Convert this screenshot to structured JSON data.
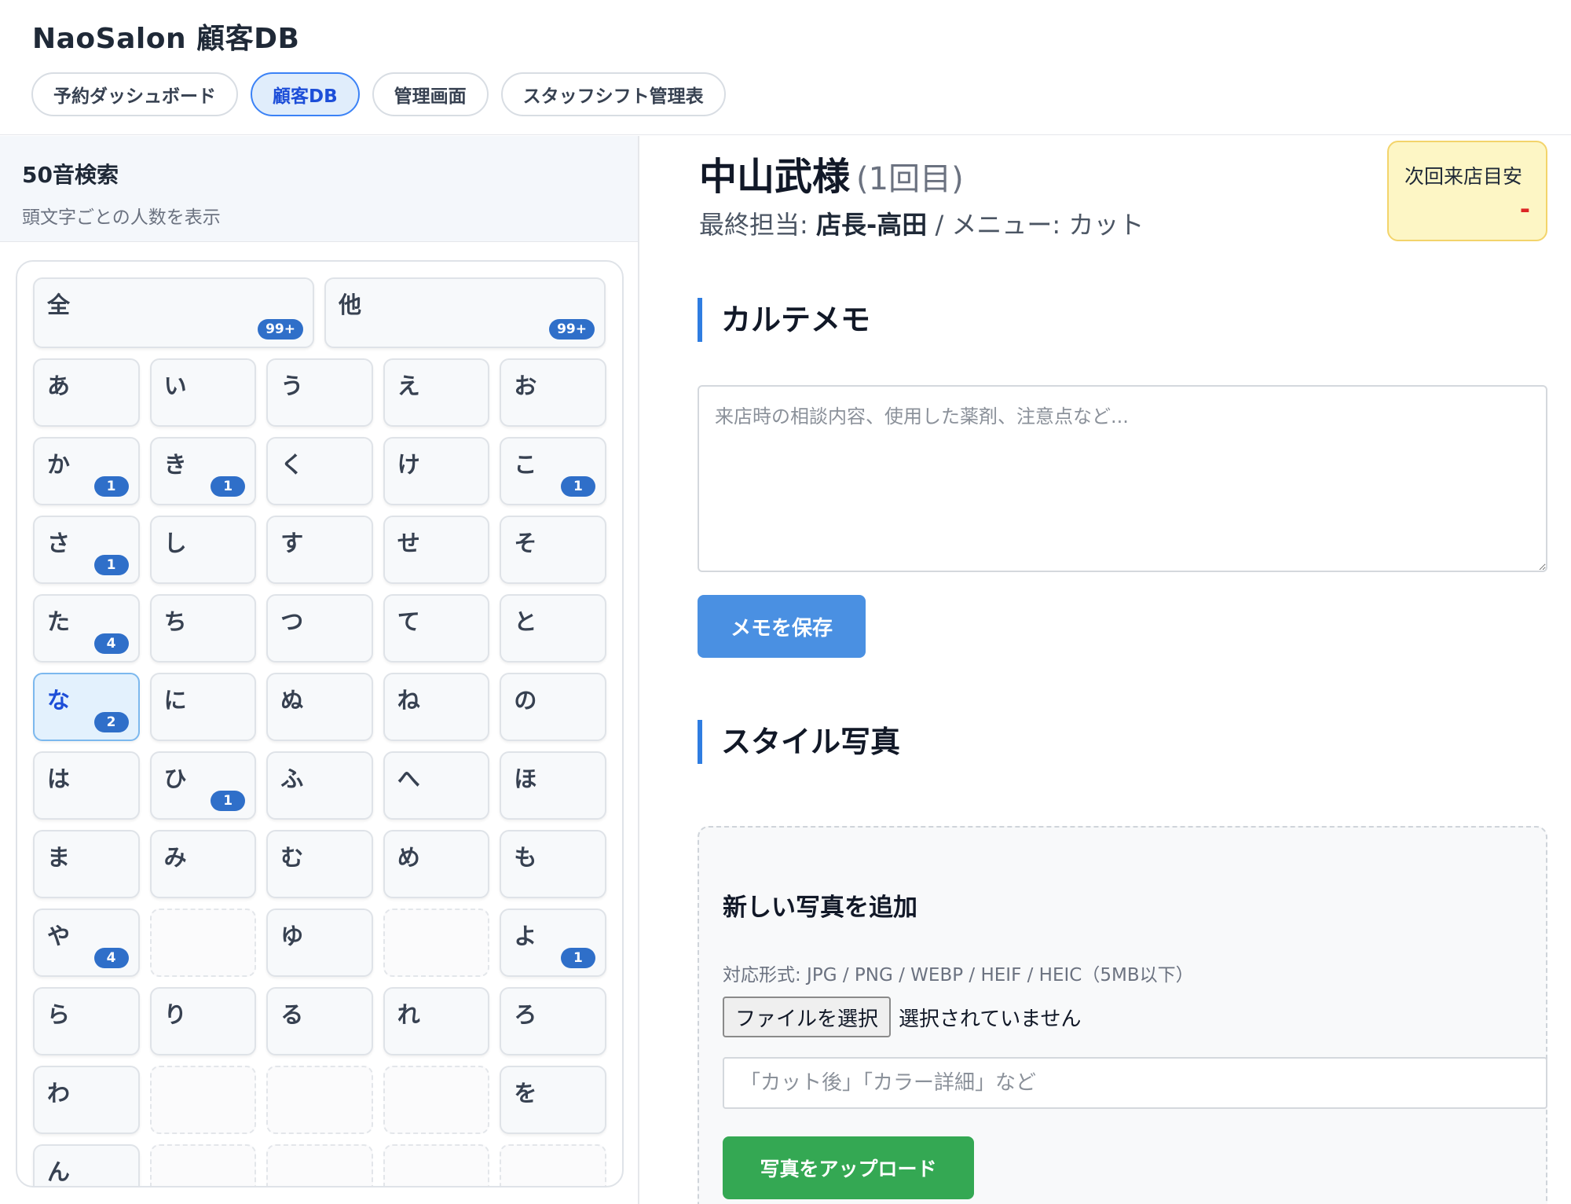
{
  "app": {
    "title": "NaoSalon 顧客DB"
  },
  "nav": [
    {
      "label": "予約ダッシュボード",
      "active": false
    },
    {
      "label": "顧客DB",
      "active": true
    },
    {
      "label": "管理画面",
      "active": false
    },
    {
      "label": "スタッフシフト管理表",
      "active": false
    }
  ],
  "sidebar": {
    "title": "50音検索",
    "subtitle": "頭文字ごとの人数を表示",
    "top_buttons": [
      {
        "char": "全",
        "count": "99+"
      },
      {
        "char": "他",
        "count": "99+"
      }
    ],
    "rows": [
      [
        {
          "char": "あ"
        },
        {
          "char": "い"
        },
        {
          "char": "う"
        },
        {
          "char": "え"
        },
        {
          "char": "お"
        }
      ],
      [
        {
          "char": "か",
          "count": "1"
        },
        {
          "char": "き",
          "count": "1"
        },
        {
          "char": "く"
        },
        {
          "char": "け"
        },
        {
          "char": "こ",
          "count": "1"
        }
      ],
      [
        {
          "char": "さ",
          "count": "1"
        },
        {
          "char": "し"
        },
        {
          "char": "す"
        },
        {
          "char": "せ"
        },
        {
          "char": "そ"
        }
      ],
      [
        {
          "char": "た",
          "count": "4"
        },
        {
          "char": "ち"
        },
        {
          "char": "つ"
        },
        {
          "char": "て"
        },
        {
          "char": "と"
        }
      ],
      [
        {
          "char": "な",
          "count": "2",
          "active": true
        },
        {
          "char": "に"
        },
        {
          "char": "ぬ"
        },
        {
          "char": "ね"
        },
        {
          "char": "の"
        }
      ],
      [
        {
          "char": "は"
        },
        {
          "char": "ひ",
          "count": "1"
        },
        {
          "char": "ふ"
        },
        {
          "char": "へ"
        },
        {
          "char": "ほ"
        }
      ],
      [
        {
          "char": "ま"
        },
        {
          "char": "み"
        },
        {
          "char": "む"
        },
        {
          "char": "め"
        },
        {
          "char": "も"
        }
      ],
      [
        {
          "char": "や",
          "count": "4"
        },
        {
          "empty": true
        },
        {
          "char": "ゆ"
        },
        {
          "empty": true
        },
        {
          "char": "よ",
          "count": "1"
        }
      ],
      [
        {
          "char": "ら"
        },
        {
          "char": "り"
        },
        {
          "char": "る"
        },
        {
          "char": "れ"
        },
        {
          "char": "ろ"
        }
      ],
      [
        {
          "char": "わ"
        },
        {
          "empty": true
        },
        {
          "empty": true
        },
        {
          "empty": true
        },
        {
          "char": "を"
        }
      ],
      [
        {
          "char": "ん"
        },
        {
          "empty": true
        },
        {
          "empty": true
        },
        {
          "empty": true
        },
        {
          "empty": true
        }
      ]
    ]
  },
  "customer": {
    "name": "中山武様",
    "visit_count": "(1回目)",
    "staff_label": "最終担当: ",
    "staff": "店長-高田",
    "separator": " / ",
    "menu_label": "メニュー: ",
    "menu": "カット"
  },
  "next_visit": {
    "label": "次回来店目安",
    "value": "-"
  },
  "memo": {
    "title": "カルテメモ",
    "placeholder": "来店時の相談内容、使用した薬剤、注意点など...",
    "value": "",
    "save_label": "メモを保存"
  },
  "photos": {
    "title": "スタイル写真",
    "card_title": "新しい写真を追加",
    "formats": "対応形式: JPG / PNG / WEBP / HEIF / HEIC（5MB以下）",
    "file_button": "ファイルを選択",
    "file_status": "選択されていません",
    "caption_placeholder": "「カット後」「カラー詳細」など",
    "upload_label": "写真をアップロード"
  },
  "colors": {
    "accent": "#2f7de1",
    "badge": "#2f6fc9",
    "save_button": "#4a90e2",
    "upload_button": "#34a853",
    "next_visit_bg": "#fdf6c5",
    "next_visit_value": "#dc2626"
  }
}
